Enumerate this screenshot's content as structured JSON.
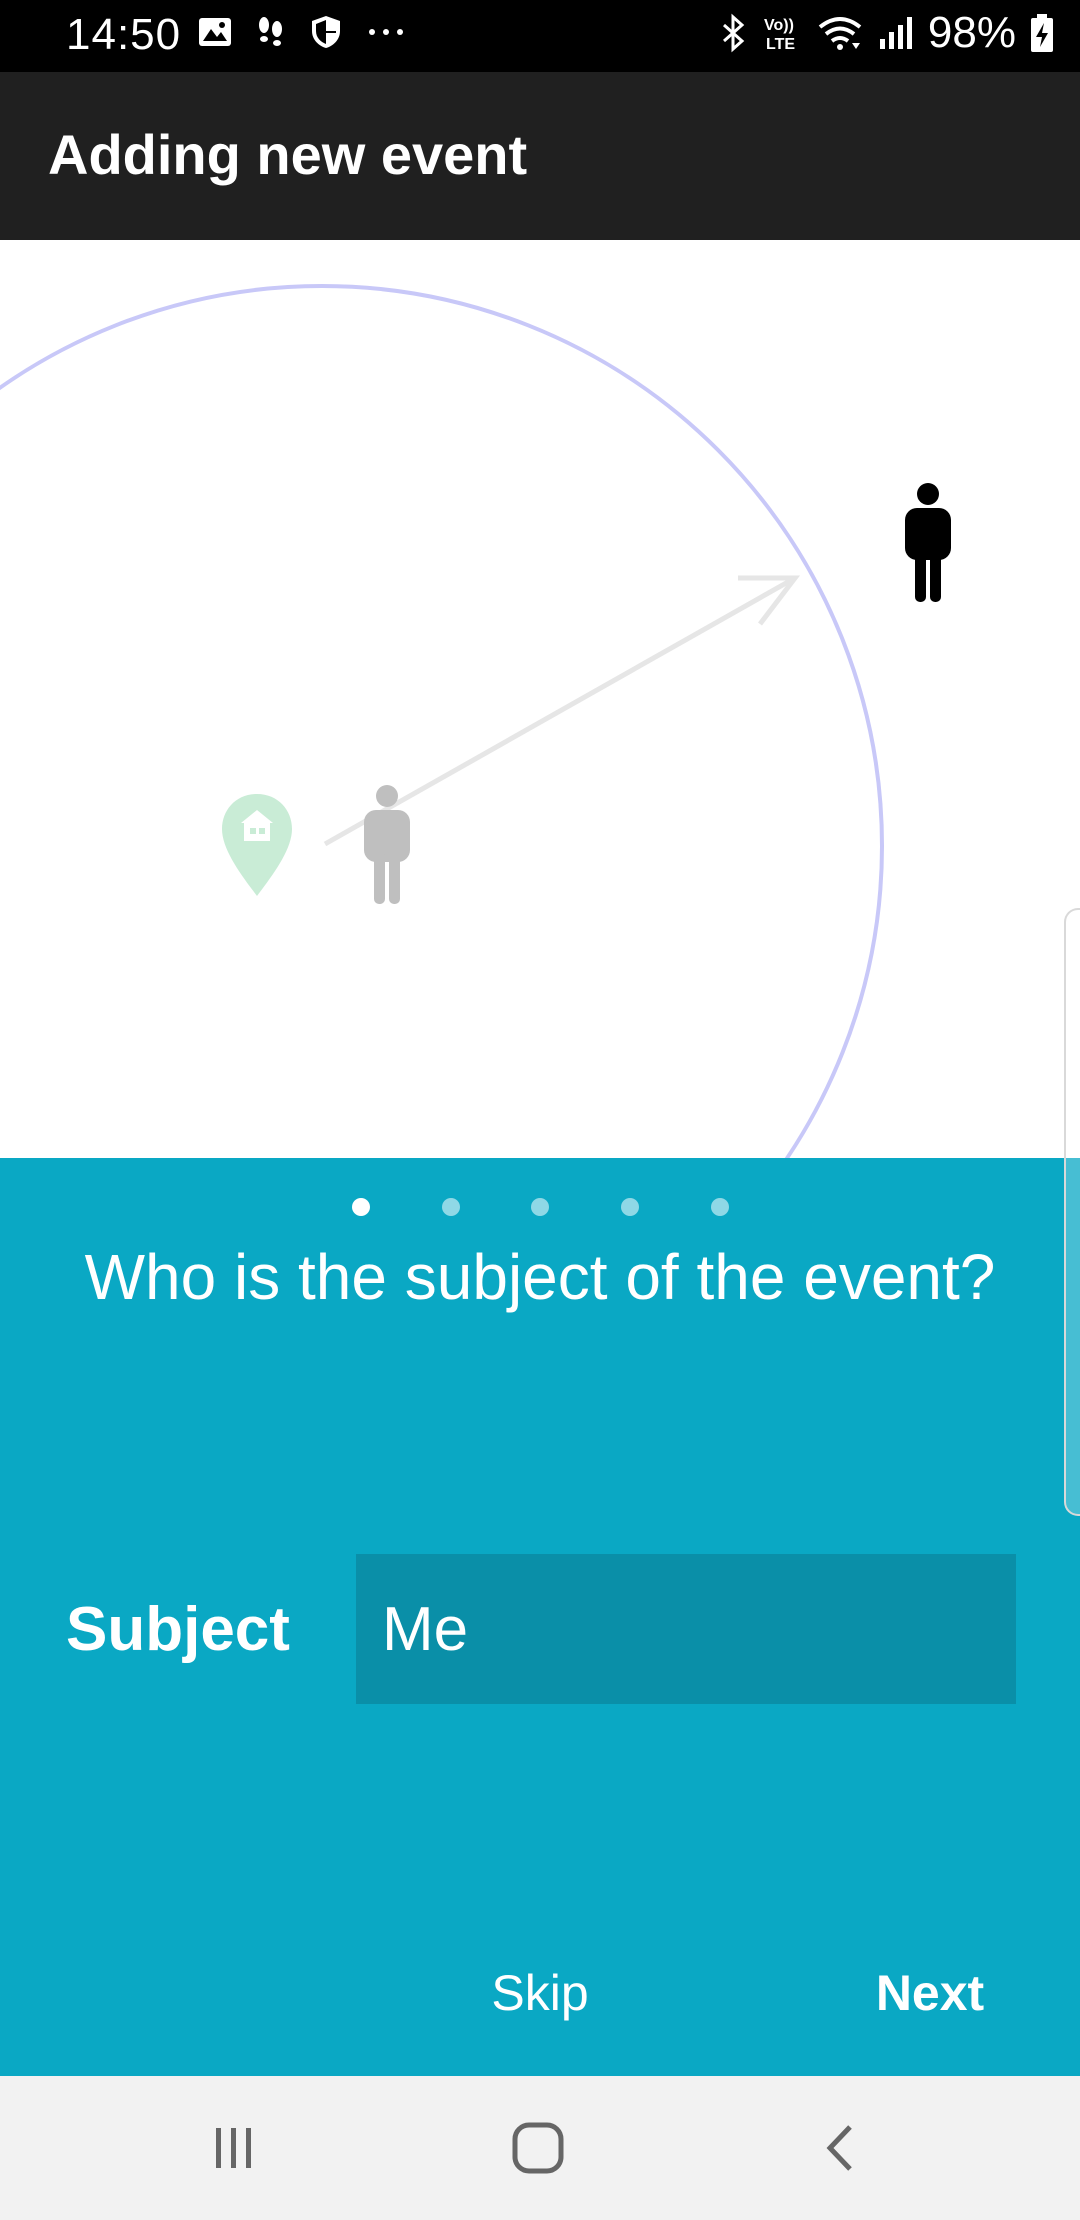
{
  "status_bar": {
    "time": "14:50",
    "battery": "98%",
    "icons": [
      "gallery-icon",
      "footsteps-icon",
      "shield-icon",
      "more-icon",
      "bluetooth-icon",
      "volte-icon",
      "wifi-icon",
      "signal-icon",
      "battery-charging-icon"
    ]
  },
  "app_bar": {
    "title": "Adding new event"
  },
  "illustration": {
    "icons": [
      "home-location-pin-icon",
      "person-grey-icon",
      "person-black-icon",
      "arrow-icon",
      "range-circle"
    ],
    "colors": {
      "circle": "#c8c8ff",
      "pin": "#c9ecd6",
      "arrow": "#e6e6e6",
      "person_grey": "#bfbfbf",
      "person_black": "#000000"
    }
  },
  "pager": {
    "count": 5,
    "active": 0
  },
  "question": "Who is the subject of the event?",
  "subject": {
    "label": "Subject",
    "value": "Me"
  },
  "actions": {
    "skip": "Skip",
    "next": "Next"
  },
  "nav_bar": {
    "icons": [
      "recent-apps-icon",
      "home-icon",
      "back-icon"
    ]
  },
  "colors": {
    "accent": "#0aa8c4",
    "input_bg": "#0a8fa8",
    "app_bar": "#202020"
  }
}
